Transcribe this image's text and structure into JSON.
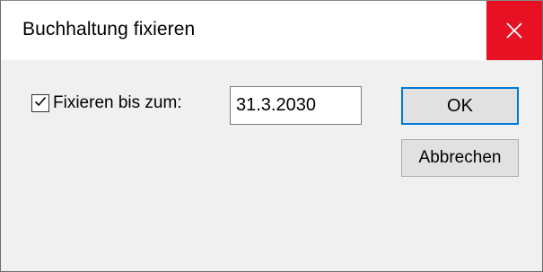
{
  "dialog": {
    "title": "Buchhaltung fixieren",
    "close_icon": "close-icon"
  },
  "form": {
    "checkbox_label": "Fixieren bis zum:",
    "checkbox_checked": true,
    "date_value": "31.3.2030"
  },
  "buttons": {
    "ok_label": "OK",
    "cancel_label": "Abbrechen"
  },
  "colors": {
    "close_button_bg": "#e81123",
    "default_button_border": "#0078d7"
  }
}
